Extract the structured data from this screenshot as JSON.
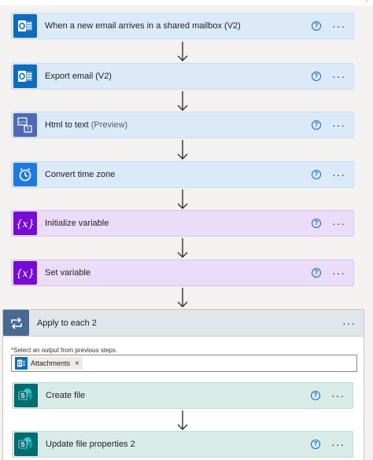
{
  "steps": [
    {
      "label": "When a new email arrives in a shared mailbox (V2)",
      "icon": "outlook-icon"
    },
    {
      "label": "Export email (V2)",
      "icon": "outlook-icon"
    },
    {
      "label": "Html to text",
      "sub": "(Preview)",
      "icon": "html-to-text-icon"
    },
    {
      "label": "Convert time zone",
      "icon": "clock-icon"
    },
    {
      "label": "Initialize variable",
      "icon": "variable-icon"
    },
    {
      "label": "Set variable",
      "icon": "variable-icon"
    }
  ],
  "apply_to_each": {
    "label": "Apply to each 2",
    "field_required_mark": "*",
    "field_label": "Select an output from previous steps",
    "token_label": "Attachments",
    "token_remove": "×"
  },
  "inner_steps": [
    {
      "label": "Create file",
      "icon": "sharepoint-icon"
    },
    {
      "label": "Update file properties 2",
      "icon": "sharepoint-icon"
    }
  ],
  "ui": {
    "help_glyph": "?",
    "more_glyph": "···"
  },
  "colors": {
    "outlook": "#0f6cbd",
    "variable": "#770bd6",
    "sharepoint": "#036c70",
    "loop": "#486991"
  }
}
